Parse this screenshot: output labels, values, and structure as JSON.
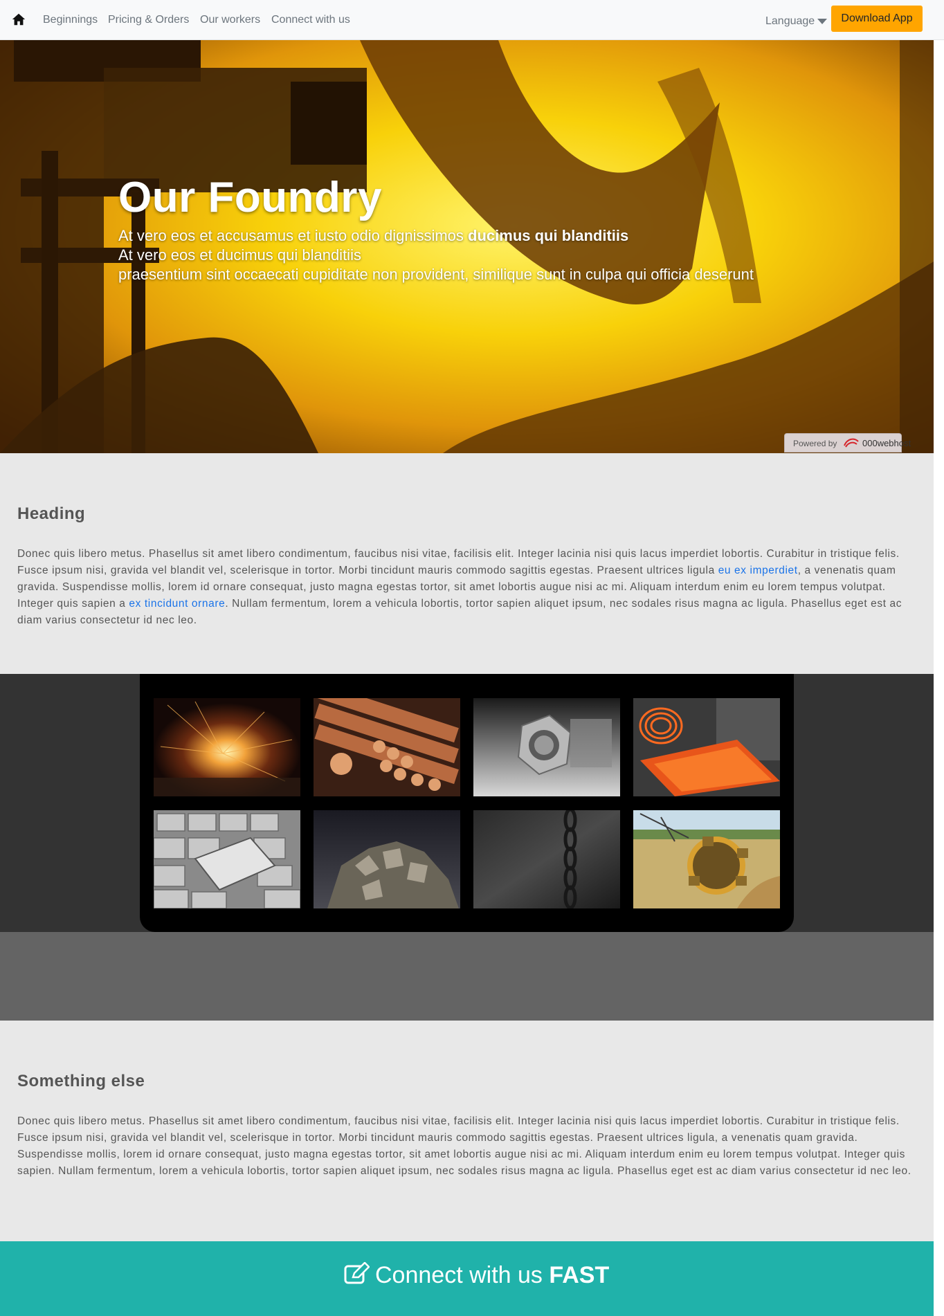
{
  "navbar": {
    "links": [
      "Beginnings",
      "Pricing & Orders",
      "Our workers",
      "Connect with us"
    ],
    "language_label": "Language",
    "download_label": "Download App"
  },
  "hero": {
    "title": "Our Foundry",
    "line1_plain": "At vero eos et accusamus et iusto odio dignissimos ",
    "line1_bold": "ducimus qui blanditiis",
    "line2": "At vero eos et ducimus qui blanditiis",
    "line3": "praesentium sint occaecati cupiditate non provident, similique sunt in culpa qui officia deserunt",
    "powered_label": "Powered by",
    "powered_brand": "000webhost"
  },
  "section1": {
    "heading": "Heading",
    "p1": "Donec quis libero metus. Phasellus sit amet libero condimentum, faucibus nisi vitae, facilisis elit. Integer lacinia nisi quis lacus imperdiet lobortis. Curabitur in tristique felis. Fusce ipsum nisi, gravida vel blandit vel, scelerisque in tortor. Morbi tincidunt mauris commodo sagittis egestas. Praesent ultrices ligula ",
    "link1": "eu ex imperdiet",
    "p2": ", a venenatis quam gravida. Suspendisse mollis, lorem id ornare consequat, justo magna egestas tortor, sit amet lobortis augue nisi ac mi. Aliquam interdum enim eu lorem tempus volutpat. Integer quis sapien a ",
    "link2": "ex tincidunt ornare",
    "p3": ". Nullam fermentum, lorem a vehicula lobortis, tortor sapien aliquet ipsum, nec sodales risus magna ac ligula. Phasellus eget est ac diam varius consectetur id nec leo."
  },
  "gallery": {
    "items": [
      "sparks-photo",
      "copper-rods-photo",
      "hex-nut-photo",
      "hot-steel-coil-photo",
      "silver-bars-photo",
      "pyrite-ore-photo",
      "chain-photo",
      "bucket-wheel-excavator-photo"
    ]
  },
  "section2": {
    "heading": "Something else",
    "text": "Donec quis libero metus. Phasellus sit amet libero condimentum, faucibus nisi vitae, facilisis elit. Integer lacinia nisi quis lacus imperdiet lobortis. Curabitur in tristique felis. Fusce ipsum nisi, gravida vel blandit vel, scelerisque in tortor. Morbi tincidunt mauris commodo sagittis egestas. Praesent ultrices ligula, a venenatis quam gravida. Suspendisse mollis, lorem id ornare consequat, justo magna egestas tortor, sit amet lobortis augue nisi ac mi. Aliquam interdum enim eu lorem tempus volutpat. Integer quis sapien. Nullam fermentum, lorem a vehicula lobortis, tortor sapien aliquet ipsum, nec sodales risus magna ac ligula. Phasellus eget est ac diam varius consectetur id nec leo."
  },
  "cta": {
    "text_plain": "Connect with us ",
    "text_bold": "FAST",
    "icon": "edit-icon"
  },
  "colors": {
    "accent_orange": "#ffa500",
    "cta_teal": "#20b2aa",
    "link_blue": "#1a73e8"
  }
}
